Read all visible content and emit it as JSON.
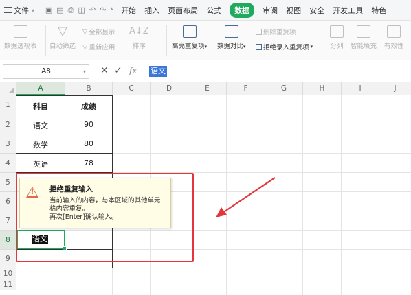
{
  "menubar": {
    "file_label": "文件",
    "tabs": [
      "开始",
      "插入",
      "页面布局",
      "公式",
      "数据",
      "审阅",
      "视图",
      "安全",
      "开发工具",
      "特色"
    ],
    "active_tab": "数据"
  },
  "ribbon": {
    "pivot": "数据透视表",
    "autofilter": "自动筛选",
    "show_all": "全部显示",
    "reapply": "重新应用",
    "sort": "排序",
    "highlight_dup": "高亮重复项",
    "compare": "数据对比",
    "remove_dup": "删除重复项",
    "reject_dup": "拒绝录入重复项",
    "split": "分列",
    "smart_fill": "智能填充",
    "validity": "有效性"
  },
  "formula_bar": {
    "name_box": "A8",
    "value": "语文"
  },
  "grid": {
    "columns": [
      "A",
      "B",
      "C",
      "D",
      "E",
      "F",
      "G",
      "H",
      "I",
      "J"
    ],
    "rows": [
      "1",
      "2",
      "3",
      "4",
      "5",
      "6",
      "7",
      "8",
      "9",
      "10",
      "11"
    ],
    "header": {
      "subject": "科目",
      "score": "成绩"
    },
    "data_rows": [
      {
        "subject": "语文",
        "score": "90"
      },
      {
        "subject": "数学",
        "score": "80"
      },
      {
        "subject": "英语",
        "score": "78"
      }
    ],
    "editing_value": "语文"
  },
  "tooltip": {
    "title": "拒绝重复输入",
    "line1": "当前输入的内容，与本区域的其他单元",
    "line2": "格内容重复。",
    "line3": "再次[Enter]确认输入。"
  },
  "colors": {
    "accent": "#1faa5d",
    "annotation": "#e2373d",
    "selection_highlight": "#3a77d8"
  }
}
